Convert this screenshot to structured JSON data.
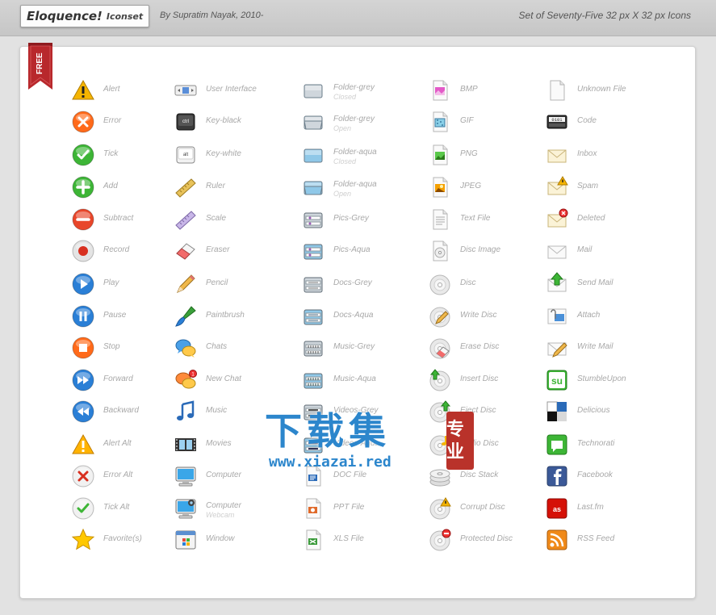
{
  "header": {
    "title": "Eloquence!",
    "subtitle": "Iconset",
    "byline": "By Supratim Nayak, 2010-",
    "set_description": "Set of Seventy-Five 32 px X 32 px Icons"
  },
  "badge": {
    "label": "FREE",
    "color": "#b8282c"
  },
  "columns": [
    [
      {
        "name": "Alert",
        "icon": "alert-icon"
      },
      {
        "name": "Error",
        "icon": "error-icon"
      },
      {
        "name": "Tick",
        "icon": "tick-icon"
      },
      {
        "name": "Add",
        "icon": "add-icon"
      },
      {
        "name": "Subtract",
        "icon": "subtract-icon"
      },
      {
        "name": "Record",
        "icon": "record-icon"
      },
      {
        "name": "Play",
        "icon": "play-icon"
      },
      {
        "name": "Pause",
        "icon": "pause-icon"
      },
      {
        "name": "Stop",
        "icon": "stop-icon"
      },
      {
        "name": "Forward",
        "icon": "forward-icon"
      },
      {
        "name": "Backward",
        "icon": "backward-icon"
      },
      {
        "name": "Alert Alt",
        "icon": "alert-alt-icon"
      },
      {
        "name": "Error Alt",
        "icon": "error-alt-icon"
      },
      {
        "name": "Tick Alt",
        "icon": "tick-alt-icon"
      },
      {
        "name": "Favorite(s)",
        "icon": "favorite-icon"
      }
    ],
    [
      {
        "name": "User Interface",
        "icon": "user-interface-icon"
      },
      {
        "name": "Key-black",
        "icon": "key-black-icon"
      },
      {
        "name": "Key-white",
        "icon": "key-white-icon"
      },
      {
        "name": "Ruler",
        "icon": "ruler-icon"
      },
      {
        "name": "Scale",
        "icon": "scale-icon"
      },
      {
        "name": "Eraser",
        "icon": "eraser-icon"
      },
      {
        "name": "Pencil",
        "icon": "pencil-icon"
      },
      {
        "name": "Paintbrush",
        "icon": "paintbrush-icon"
      },
      {
        "name": "Chats",
        "icon": "chats-icon"
      },
      {
        "name": "New Chat",
        "icon": "new-chat-icon"
      },
      {
        "name": "Music",
        "icon": "music-icon"
      },
      {
        "name": "Movies",
        "icon": "movies-icon"
      },
      {
        "name": "Computer",
        "icon": "computer-icon"
      },
      {
        "name": "Computer",
        "sub": "Webcam",
        "icon": "computer-webcam-icon"
      },
      {
        "name": "Window",
        "icon": "window-icon"
      }
    ],
    [
      {
        "name": "Folder-grey",
        "sub": "Closed",
        "icon": "folder-grey-closed-icon"
      },
      {
        "name": "Folder-grey",
        "sub": "Open",
        "icon": "folder-grey-open-icon"
      },
      {
        "name": "Folder-aqua",
        "sub": "Closed",
        "icon": "folder-aqua-closed-icon"
      },
      {
        "name": "Folder-aqua",
        "sub": "Open",
        "icon": "folder-aqua-open-icon"
      },
      {
        "name": "Pics-Grey",
        "icon": "pics-grey-icon"
      },
      {
        "name": "Pics-Aqua",
        "icon": "pics-aqua-icon"
      },
      {
        "name": "Docs-Grey",
        "icon": "docs-grey-icon"
      },
      {
        "name": "Docs-Aqua",
        "icon": "docs-aqua-icon"
      },
      {
        "name": "Music-Grey",
        "icon": "music-grey-icon"
      },
      {
        "name": "Music-Aqua",
        "icon": "music-aqua-icon"
      },
      {
        "name": "Videos-Grey",
        "icon": "videos-grey-icon"
      },
      {
        "name": "Videos-Aqua",
        "icon": "videos-aqua-icon"
      },
      {
        "name": "DOC File",
        "icon": "doc-file-icon"
      },
      {
        "name": "PPT File",
        "icon": "ppt-file-icon"
      },
      {
        "name": "XLS File",
        "icon": "xls-file-icon"
      }
    ],
    [
      {
        "name": "BMP",
        "icon": "bmp-icon"
      },
      {
        "name": "GIF",
        "icon": "gif-icon"
      },
      {
        "name": "PNG",
        "icon": "png-icon"
      },
      {
        "name": "JPEG",
        "icon": "jpeg-icon"
      },
      {
        "name": "Text File",
        "icon": "text-file-icon"
      },
      {
        "name": "Disc Image",
        "icon": "disc-image-icon"
      },
      {
        "name": "Disc",
        "icon": "disc-icon"
      },
      {
        "name": "Write Disc",
        "icon": "write-disc-icon"
      },
      {
        "name": "Erase Disc",
        "icon": "erase-disc-icon"
      },
      {
        "name": "Insert Disc",
        "icon": "insert-disc-icon"
      },
      {
        "name": "Eject Disc",
        "icon": "eject-disc-icon"
      },
      {
        "name": "Audio Disc",
        "icon": "audio-disc-icon"
      },
      {
        "name": "Disc Stack",
        "icon": "disc-stack-icon"
      },
      {
        "name": "Corrupt Disc",
        "icon": "corrupt-disc-icon"
      },
      {
        "name": "Protected Disc",
        "icon": "protected-disc-icon"
      }
    ],
    [
      {
        "name": "Unknown File",
        "icon": "unknown-file-icon"
      },
      {
        "name": "Code",
        "icon": "code-icon"
      },
      {
        "name": "Inbox",
        "icon": "inbox-icon"
      },
      {
        "name": "Spam",
        "icon": "spam-icon"
      },
      {
        "name": "Deleted",
        "icon": "deleted-icon"
      },
      {
        "name": "Mail",
        "icon": "mail-icon"
      },
      {
        "name": "Send Mail",
        "icon": "send-mail-icon"
      },
      {
        "name": "Attach",
        "icon": "attach-icon"
      },
      {
        "name": "Write Mail",
        "icon": "write-mail-icon"
      },
      {
        "name": "StumbleUpon",
        "icon": "stumbleupon-icon"
      },
      {
        "name": "Delicious",
        "icon": "delicious-icon"
      },
      {
        "name": "Technorati",
        "icon": "technorati-icon"
      },
      {
        "name": "Facebook",
        "icon": "facebook-icon"
      },
      {
        "name": "Last.fm",
        "icon": "lastfm-icon"
      },
      {
        "name": "RSS Feed",
        "icon": "rss-feed-icon"
      }
    ]
  ],
  "watermark": {
    "main": "下载集",
    "url": "www.xiazai.red",
    "seal": "专业"
  }
}
